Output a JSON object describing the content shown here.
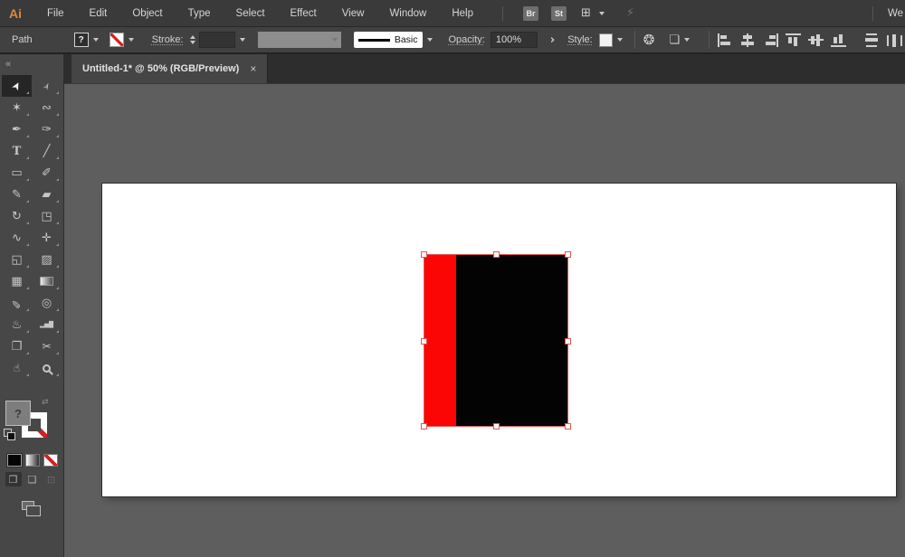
{
  "app": {
    "logo": "Ai",
    "workspace_label": "We"
  },
  "menubar": {
    "items": [
      "File",
      "Edit",
      "Object",
      "Type",
      "Select",
      "Effect",
      "View",
      "Window",
      "Help"
    ],
    "bridge_button": "Br",
    "stock_button": "St"
  },
  "controlbar": {
    "selection_type": "Path",
    "fill_indicator": "?",
    "stroke_label": "Stroke:",
    "stroke_weight_value": "",
    "brush_name": "Basic",
    "opacity_label": "Opacity:",
    "opacity_value": "100%",
    "opacity_panel_arrow": "›",
    "style_label": "Style:",
    "align_icons": [
      "align-left",
      "align-h-center",
      "align-right",
      "align-top",
      "align-v-center",
      "align-bottom",
      "distribute-v",
      "distribute-h"
    ]
  },
  "tabbar": {
    "title": "Untitled-1* @ 50% (RGB/Preview)",
    "close": "×"
  },
  "toolbar": {
    "collapse": "«",
    "tools": [
      {
        "name": "selection",
        "glyph": "➤",
        "active": true
      },
      {
        "name": "direct-selection",
        "glyph": "➢"
      },
      {
        "name": "magic-wand",
        "glyph": "✶"
      },
      {
        "name": "lasso",
        "glyph": "∾"
      },
      {
        "name": "pen",
        "glyph": "✒"
      },
      {
        "name": "curvature",
        "glyph": "✑"
      },
      {
        "name": "type",
        "glyph": "T"
      },
      {
        "name": "line",
        "glyph": "╱"
      },
      {
        "name": "rectangle",
        "glyph": "▭"
      },
      {
        "name": "paintbrush",
        "glyph": "✐"
      },
      {
        "name": "shaper",
        "glyph": "✎"
      },
      {
        "name": "eraser",
        "glyph": "▰"
      },
      {
        "name": "rotate",
        "glyph": "↻"
      },
      {
        "name": "scale",
        "glyph": "◳"
      },
      {
        "name": "width",
        "glyph": "∿"
      },
      {
        "name": "puppet-warp",
        "glyph": "✛"
      },
      {
        "name": "shape-builder",
        "glyph": "◱"
      },
      {
        "name": "perspective-grid",
        "glyph": "▨"
      },
      {
        "name": "mesh",
        "glyph": "▦"
      },
      {
        "name": "gradient",
        "glyph": "",
        "css": "grad"
      },
      {
        "name": "eyedropper",
        "glyph": "✏"
      },
      {
        "name": "blend",
        "glyph": "◎"
      },
      {
        "name": "symbol-sprayer",
        "glyph": "♨"
      },
      {
        "name": "column-graph",
        "glyph": "▂▅█"
      },
      {
        "name": "artboard",
        "glyph": "❐"
      },
      {
        "name": "slice",
        "glyph": "✂"
      },
      {
        "name": "hand",
        "glyph": "☝"
      },
      {
        "name": "zoom",
        "glyph": "",
        "css": "zoom"
      }
    ]
  },
  "proxies": {
    "fill_indicator": "?"
  },
  "icons": {
    "arrange_documents": "⊞",
    "sync": "⚡",
    "swap": "⇄",
    "recolor_wheel": "❂",
    "select_similar": "❏",
    "draw_normal": "❒",
    "draw_behind": "❑",
    "draw_inside": "⊡",
    "cursor": "➤"
  },
  "colors": {
    "logo_accent": "#e0883c",
    "menubar_bg": "#3a3a3a",
    "controlbar_bg": "#414141",
    "tabbar_bg": "#2d2d2d",
    "tab_bg": "#454545",
    "toolbar_bg": "#474747",
    "canvas_bg": "#5e5e5e",
    "artboard": "#ffffff",
    "selection_outline": "#e4554f",
    "object_left_fill": "#fb0505",
    "object_right_fill": "#030303",
    "stroke_none_slash": "#d81e1e"
  }
}
